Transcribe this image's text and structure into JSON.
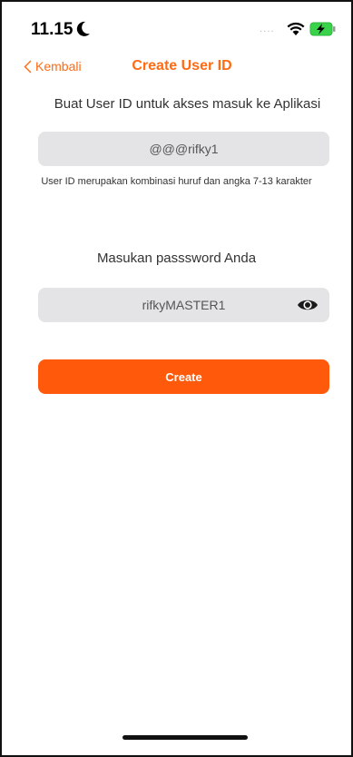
{
  "status_bar": {
    "time": "11.15",
    "moon_icon": "moon-icon",
    "signal_icon": "signal-dots-icon",
    "wifi_icon": "wifi-icon",
    "battery_icon": "battery-charging-icon",
    "battery_color": "#3ad24a"
  },
  "nav": {
    "back_label": "Kembali",
    "title": "Create User ID",
    "accent": "#ff6a13"
  },
  "form": {
    "subtitle": "Buat User ID untuk akses masuk ke Aplikasi",
    "userid_value": "@@@rifky1",
    "userid_hint": "User ID merupakan kombinasi huruf dan angka 7-13 karakter",
    "password_label": "Masukan passsword Anda",
    "password_value": "rifkyMASTER1",
    "eye_icon": "eye-icon",
    "field_bg": "#e4e4e7"
  },
  "actions": {
    "create_label": "Create",
    "create_color": "#ff5a0c"
  }
}
